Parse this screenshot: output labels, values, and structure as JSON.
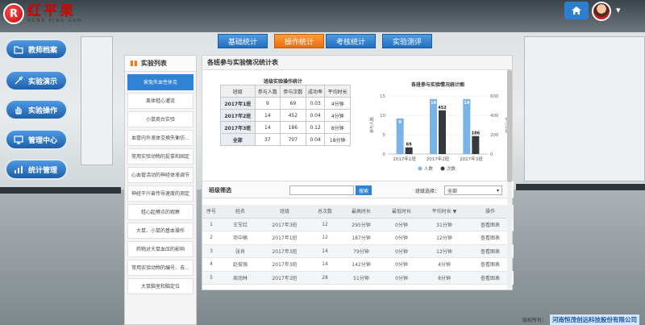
{
  "brand": {
    "logo_cn": "红平果",
    "logo_en": "HONG PING GUO",
    "logo_mark": "R"
  },
  "header": {
    "home_icon": "home-icon",
    "user_avatar": "user-avatar"
  },
  "nav": {
    "items": [
      {
        "id": "teacher-files",
        "label": "教师档案",
        "icon": "folder-icon"
      },
      {
        "id": "demo",
        "label": "实验演示",
        "icon": "syringe-icon"
      },
      {
        "id": "operation",
        "label": "实验操作",
        "icon": "hand-icon"
      },
      {
        "id": "admin",
        "label": "管理中心",
        "icon": "monitor-icon"
      },
      {
        "id": "stats",
        "label": "统计管理",
        "icon": "bar-chart-icon"
      }
    ]
  },
  "tabs": [
    {
      "label": "基础统计",
      "active": false
    },
    {
      "label": "操作统计",
      "active": true
    },
    {
      "label": "考核统计",
      "active": false
    },
    {
      "label": "实验测评",
      "active": false
    }
  ],
  "experiments": {
    "title": "实验列表",
    "items": [
      "家兔失血性休克",
      "离体蛙心灌流",
      "小鼠商台实验",
      "血管内外液体交换失衡仿...",
      "常用实验动物的捉拿和固定",
      "心血管活动的神经体液调节",
      "神经干兴奋传导速度的测定",
      "蛙心起搏点的观察",
      "大鼠、小鼠的基本操作",
      "药物对大鼠血压的影响",
      "常用实验动物的编号、去...",
      "大鼠脑室和脑定位"
    ],
    "active_index": 0
  },
  "main": {
    "title": "各班参与实验情况统计表",
    "stats_table": {
      "title": "班级实验操作统计",
      "headers": [
        "班级",
        "参与人数",
        "参与次数",
        "成功率",
        "平均时长"
      ],
      "rows": [
        [
          "2017年1班",
          "9",
          "69",
          "0.03",
          "4分钟"
        ],
        [
          "2017年2班",
          "14",
          "452",
          "0.04",
          "4分钟"
        ],
        [
          "2017年3班",
          "14",
          "186",
          "0.12",
          "8分钟"
        ],
        [
          "全部",
          "37",
          "707",
          "0.04",
          "18分钟"
        ]
      ]
    },
    "filter": {
      "label": "班级筛选",
      "search_value": "",
      "search_placeholder": "",
      "search_button": "搜索",
      "class_label": "班级选择：",
      "class_value": "全部"
    },
    "records": {
      "headers": [
        "序号",
        "姓名",
        "班级",
        "总次数",
        "最高时长",
        "最低时长",
        "平均时长",
        "操作"
      ],
      "sort_glyph": "▼",
      "rows": [
        [
          "1",
          "王军红",
          "2017年3班",
          "12",
          "295分钟",
          "0分钟",
          "31分钟",
          "查看图表"
        ],
        [
          "2",
          "邓中楠",
          "2017年1班",
          "12",
          "187分钟",
          "0分钟",
          "12分钟",
          "查看图表"
        ],
        [
          "3",
          "张肖",
          "2017年3班",
          "14",
          "79分钟",
          "0分钟",
          "12分钟",
          "查看图表"
        ],
        [
          "4",
          "赵俊强",
          "2017年3班",
          "14",
          "142分钟",
          "0分钟",
          "4分钟",
          "查看图表"
        ],
        [
          "5",
          "周润林",
          "2017年3班",
          "28",
          "51分钟",
          "0分钟",
          "8分钟",
          "查看图表"
        ]
      ]
    }
  },
  "chart_data": {
    "type": "bar",
    "title": "各班参与实验情况统计图",
    "categories": [
      "2017年1班",
      "2017年2班",
      "2017年3班"
    ],
    "series": [
      {
        "name": "人数",
        "values": [
          9,
          14,
          14
        ],
        "color": "#7ab3e8",
        "axis": "left"
      },
      {
        "name": "次数",
        "values": [
          69,
          452,
          186
        ],
        "color": "#333a40",
        "axis": "right"
      }
    ],
    "ylabel": "参与人数",
    "y2label": "参与次数",
    "ylim": [
      0,
      15
    ],
    "y2lim": [
      0,
      600
    ],
    "yticks": [
      0,
      5,
      10,
      15
    ],
    "y2ticks": [
      0,
      200,
      400,
      600
    ],
    "legend": "bottom",
    "grid": true
  },
  "footer": {
    "label": "版权所有：",
    "company": "河南恒茂创远科技股份有限公司"
  }
}
